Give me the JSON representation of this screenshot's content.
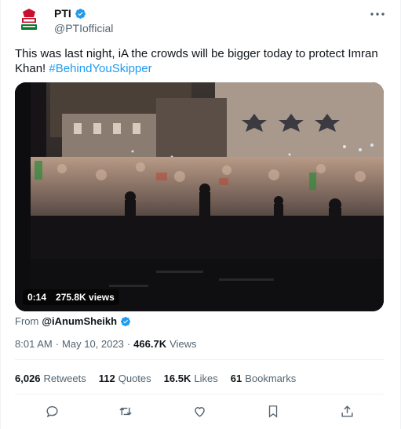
{
  "author": {
    "display_name": "PTI",
    "username": "@PTIofficial",
    "verified": true,
    "avatar_icon": "pti-logo-icon"
  },
  "tweet": {
    "text": "This was last night, iA the crowds will be bigger today to protect Imran Khan! ",
    "hashtag": "#BehindYouSkipper"
  },
  "media": {
    "duration": "0:14",
    "views_label": "275.8K views"
  },
  "source": {
    "prefix": "From",
    "user": "@iAnumSheikh"
  },
  "meta": {
    "time": "8:01 AM",
    "separator": "·",
    "date": "May 10, 2023",
    "views_count": "466.7K",
    "views_label": "Views"
  },
  "stats": [
    {
      "count": "6,026",
      "label": "Retweets"
    },
    {
      "count": "112",
      "label": "Quotes"
    },
    {
      "count": "16.5K",
      "label": "Likes"
    },
    {
      "count": "61",
      "label": "Bookmarks"
    }
  ],
  "colors": {
    "accent": "#1d9bf0",
    "text": "#0f1419",
    "muted": "#536471"
  },
  "actions": [
    "reply-icon",
    "retweet-icon",
    "like-icon",
    "bookmark-icon",
    "share-icon"
  ]
}
